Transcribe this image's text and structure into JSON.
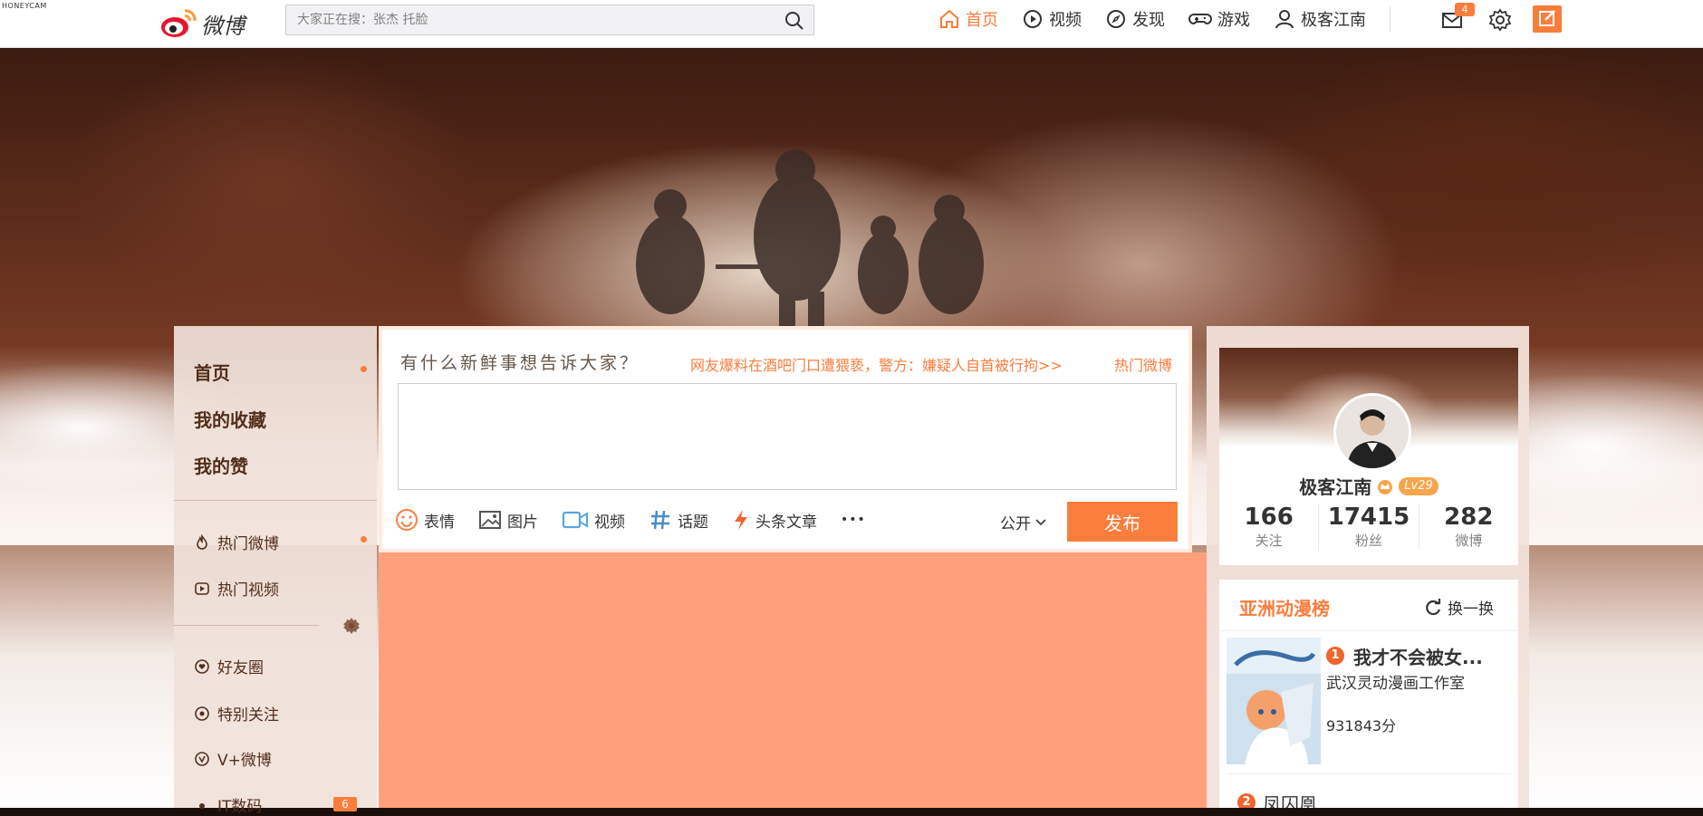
{
  "watermark": "HONEYCAM",
  "brand": {
    "name": "微博",
    "accent": "#fa7d3c"
  },
  "search": {
    "placeholder": "大家正在搜：张杰 托脸"
  },
  "nav": [
    {
      "label": "首页",
      "icon": "home-icon",
      "active": true
    },
    {
      "label": "视频",
      "icon": "video-play-icon"
    },
    {
      "label": "发现",
      "icon": "compass-icon"
    },
    {
      "label": "游戏",
      "icon": "gamepad-icon"
    },
    {
      "label": "极客江南",
      "icon": "user-icon"
    }
  ],
  "messages": {
    "count": "4"
  },
  "sidebar": {
    "main": [
      "首页",
      "我的收藏",
      "我的赞"
    ],
    "hot": [
      "热门微博",
      "热门视频"
    ],
    "groups": [
      "好友圈",
      "特别关注",
      "V+微博"
    ],
    "tags": [
      {
        "label": "IT数码",
        "count": "6"
      }
    ]
  },
  "composer": {
    "title": "有什么新鲜事想告诉大家？",
    "hot_topic": "网友爆料在酒吧门口遭猥亵，警方：嫌疑人自首被行拘>>",
    "hot_link": "热门微博",
    "tools": [
      "表情",
      "图片",
      "视频",
      "话题",
      "头条文章"
    ],
    "more": "•••",
    "visibility": "公开",
    "publish": "发布"
  },
  "profile": {
    "name": "极客江南",
    "level": "Lv29",
    "stats": [
      {
        "num": "166",
        "label": "关注"
      },
      {
        "num": "17415",
        "label": "粉丝"
      },
      {
        "num": "282",
        "label": "微博"
      }
    ]
  },
  "ranking": {
    "title": "亚洲动漫榜",
    "refresh": "换一换",
    "items": [
      {
        "rank": "1",
        "name": "我才不会被女...",
        "author": "武汉灵动漫画工作室",
        "score": "931843分"
      },
      {
        "rank": "2",
        "name": "凤囚凰"
      }
    ]
  }
}
